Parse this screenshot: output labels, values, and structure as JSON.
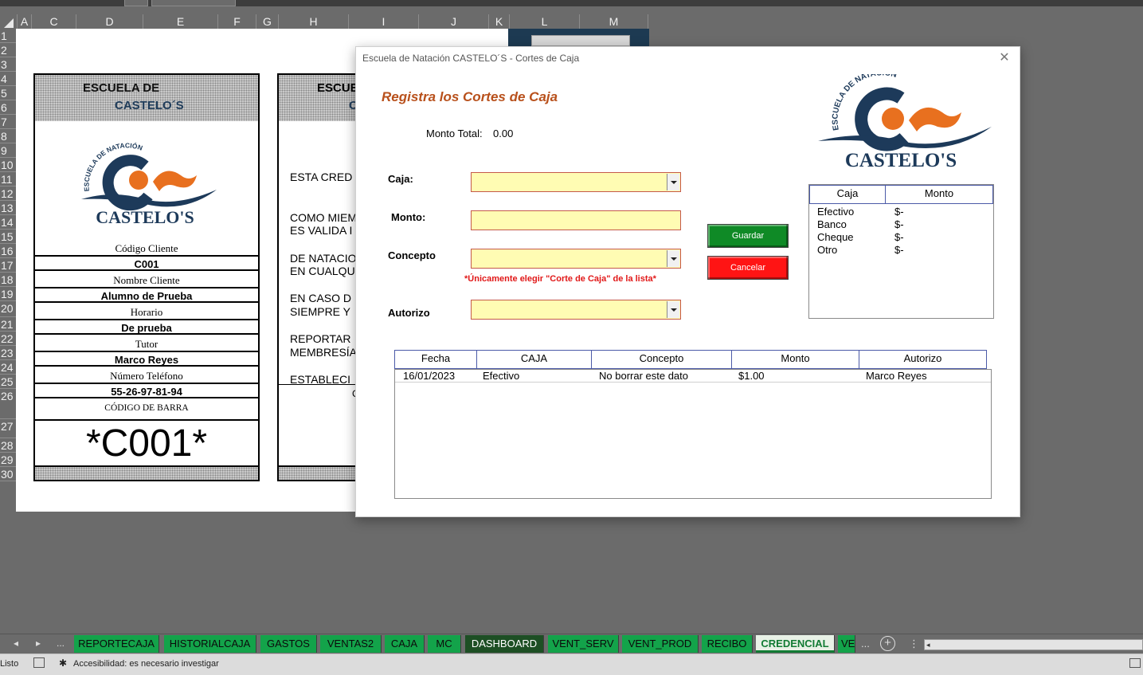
{
  "columns": [
    "A",
    "C",
    "D",
    "E",
    "F",
    "G",
    "H",
    "I",
    "J",
    "K",
    "L",
    "M"
  ],
  "rows": [
    "1",
    "2",
    "3",
    "4",
    "5",
    "6",
    "7",
    "8",
    "9",
    "10",
    "11",
    "12",
    "13",
    "14",
    "15",
    "16",
    "17",
    "18",
    "19",
    "20",
    "21",
    "22",
    "23",
    "24",
    "25",
    "26",
    "27",
    "28",
    "29",
    "30"
  ],
  "card": {
    "header_line1": "ESCUELA DE",
    "header_line2": "CASTELO´S",
    "logo_arc_text": "ESCUELA DE NATACIÓN",
    "logo_name": "CASTELO'S",
    "codigo_label": "Código Cliente",
    "codigo_value": "C001",
    "nombre_label": "Nombre Cliente",
    "nombre_value": "Alumno de Prueba",
    "horario_label": "Horario",
    "horario_value": "De prueba",
    "tutor_label": "Tutor",
    "tutor_value": "Marco Reyes",
    "telefono_label": "Número Teléfono",
    "telefono_value": "55-26-97-81-94",
    "barra_label": "CÓDIGO DE BARRA",
    "barcode": "*C001*"
  },
  "card2": {
    "header_line1": "ESCUE",
    "header_line2": "C",
    "p1": [
      "ESTA CRED",
      "COMO MIEM",
      "DE NATACIO"
    ],
    "p2": [
      "ES VALIDA I",
      "EN CUALQU",
      "SIEMPRE Y",
      "MEMBRESÍA"
    ],
    "p3": [
      "EN CASO D",
      "REPORTAR",
      "ESTABLECI"
    ],
    "footer_char": "C"
  },
  "dialog": {
    "title": "Escuela de Natación CASTELO´S - Cortes de Caja",
    "close": "✕",
    "heading": "Registra los Cortes de Caja",
    "monto_total_label": "Monto Total:",
    "monto_total_value": "0.00",
    "caja_label": "Caja:",
    "monto_label": "Monto:",
    "concepto_label": "Concepto",
    "concepto_note": "*Únicamente elegir \"Corte de Caja\" de la lista*",
    "autorizo_label": "Autorizo",
    "guardar": "Guardar",
    "cancelar": "Cancelar",
    "logo_arc_text": "ESCUELA DE NATACIÓN",
    "logo_name": "CASTELO'S",
    "summary": {
      "headers": [
        "Caja",
        "Monto"
      ],
      "rows": [
        {
          "caja": "Efectivo",
          "monto": "$-"
        },
        {
          "caja": "Banco",
          "monto": "$-"
        },
        {
          "caja": "Cheque",
          "monto": "$-"
        },
        {
          "caja": "Otro",
          "monto": "$-"
        }
      ]
    },
    "table": {
      "headers": [
        "Fecha",
        "CAJA",
        "Concepto",
        "Monto",
        "Autorizo"
      ],
      "rows": [
        {
          "fecha": "16/01/2023",
          "caja": "Efectivo",
          "concepto": "No borrar este dato",
          "monto": "$1.00",
          "autorizo": "Marco Reyes"
        }
      ]
    }
  },
  "sheet_tabs": [
    "REPORTECAJA",
    "HISTORIALCAJA",
    "GASTOS",
    "VENTAS2",
    "CAJA",
    "MC",
    "DASHBOARD",
    "VENT_SERV",
    "VENT_PROD",
    "RECIBO",
    "CREDENCIAL",
    "VE"
  ],
  "active_tab": "CREDENCIAL",
  "tab_nav": {
    "prev": "◂",
    "next": "▸",
    "more_left": "...",
    "more_right": "...",
    "add": "+",
    "options": "⋮"
  },
  "status": {
    "ready": "Listo",
    "accessibility": "Accesibilidad: es necesario investigar"
  },
  "colors": {
    "tab_green": "#13a34a",
    "tab_dark": "#1d4f24",
    "field_yellow": "#fffcb3",
    "heading_orange": "#b8501b",
    "guardar_green": "#0f8a26",
    "cancelar_red": "#ff1414"
  }
}
